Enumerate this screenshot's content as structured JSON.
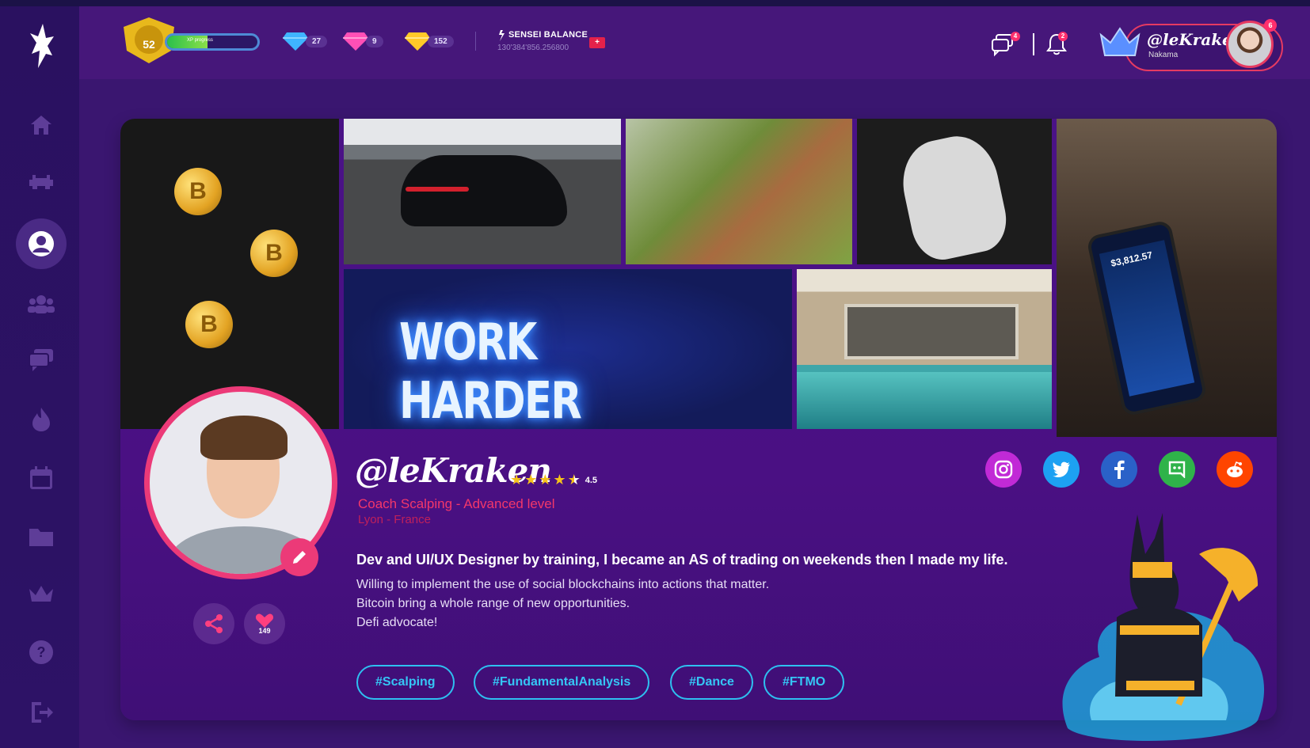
{
  "header": {
    "level": "52",
    "xp_label": "XP progress",
    "xp_progress": 0.45,
    "gems": [
      {
        "name": "blue-gem",
        "count": "27",
        "color": "#3fb4ff"
      },
      {
        "name": "pink-gem",
        "count": "9",
        "color": "#ff4fb6"
      },
      {
        "name": "gold-gem",
        "count": "152",
        "color": "#ffc928"
      }
    ],
    "sensei_title": "SENSEI BALANCE",
    "sensei_value": "130'384'856.256800",
    "flag": "+",
    "messages_badge": "4",
    "notifications_badge": "2",
    "user_handle": "@leKraken",
    "user_rank": "Nakama",
    "avatar_badge": "6"
  },
  "sidebar": {
    "items": [
      "home-icon",
      "gamepad-icon",
      "user-icon",
      "community-icon",
      "chat-icon",
      "fire-icon",
      "calendar-icon",
      "folder-icon",
      "crown-icon",
      "help-icon",
      "logout-icon"
    ],
    "active": "user-icon"
  },
  "gallery": {
    "neon_text": "WORK HARDER",
    "phone_value": "$3,812.57",
    "coin_symbol": "B"
  },
  "profile": {
    "handle": "@leKraken",
    "rating": "4.5",
    "stars": 4.5,
    "title": "Coach Scalping - Advanced level",
    "location": "Lyon - France",
    "bio_lead": "Dev and UI/UX Designer by training, I became an AS of trading on weekends then I made my life.",
    "bio_lines": [
      "Willing to implement the use of social blockchains into actions that matter.",
      "Bitcoin bring a whole range of new opportunities.",
      "Defi advocate!"
    ],
    "likes": "149",
    "tags": [
      "#Scalping",
      "#FundamentalAnalysis",
      "#Dance",
      "#FTMO"
    ],
    "socials": [
      {
        "name": "instagram",
        "color": "#c12ad6"
      },
      {
        "name": "twitter",
        "color": "#1da1f2"
      },
      {
        "name": "facebook",
        "color": "#2a61c8"
      },
      {
        "name": "discord",
        "color": "#2fb34a"
      },
      {
        "name": "reddit",
        "color": "#ff4500"
      }
    ]
  }
}
